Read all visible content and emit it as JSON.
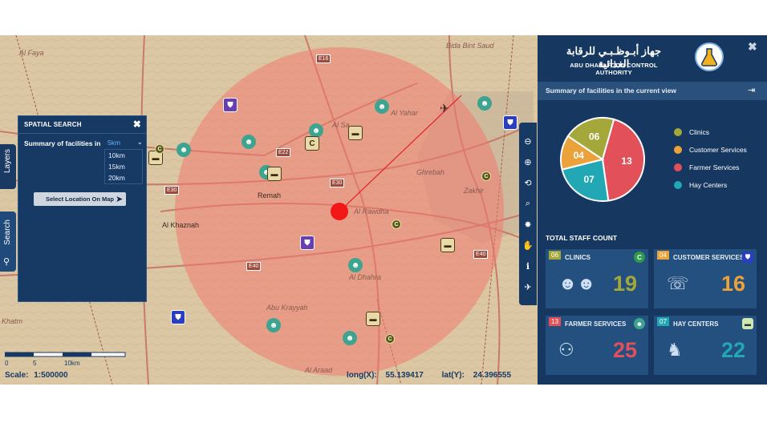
{
  "map": {
    "places": {
      "al_faya": "Al Faya",
      "bida_bint_saud": "Bida Bint Saud",
      "al_yahar": "Al Yahar",
      "al_sa": "Al Sa",
      "remah": "Remah",
      "al_khaznah": "Al Khaznah",
      "al_rawdha": "Al Rawdha",
      "ghrebah": "Ghrebah",
      "zakhir": "Zakhir",
      "al_dhahra": "Al Dhahra",
      "abu_krayyah": "Abu Krayyah",
      "khatm": "Khatm",
      "al_araad": "Al Araad"
    },
    "road_shields": [
      "E16",
      "E22",
      "E30",
      "E30",
      "E40",
      "E40"
    ],
    "scale_ticks": [
      "0",
      "5",
      "10km"
    ],
    "scale_label": "Scale:",
    "scale_value": "1:500000",
    "long_label": "long(X):",
    "long_value": "55.139417",
    "lat_label": "lat(Y):",
    "lat_value": "24.396555"
  },
  "side_tabs": {
    "layers": "Layers",
    "search": "Search"
  },
  "spatial_search": {
    "title": "SPATIAL SEARCH",
    "close": "✖",
    "summary_label": "Summary of facilities in",
    "selected": "5km",
    "options": [
      "10km",
      "15km",
      "20km"
    ],
    "button": "Select Location On Map"
  },
  "panel": {
    "arabic_name": "جهاز أبـوظـبـي للرقابة الغذائية",
    "english_name": "ABU DHABI FOOD CONTROL AUTHORITY",
    "close": "✖",
    "summary_title": "Summary of facilities in the current view",
    "legend": [
      {
        "label": "Clinics",
        "color": "#a4a83a"
      },
      {
        "label": "Customer Services",
        "color": "#eba23a"
      },
      {
        "label": "Farmer Services",
        "color": "#e2505a"
      },
      {
        "label": "Hay Centers",
        "color": "#22a7b5"
      }
    ],
    "pie": [
      {
        "label": "06",
        "value": 6,
        "color": "#a4a83a"
      },
      {
        "label": "13",
        "value": 13,
        "color": "#e2505a"
      },
      {
        "label": "07",
        "value": 7,
        "color": "#22a7b5"
      },
      {
        "label": "04",
        "value": 4,
        "color": "#eba23a"
      }
    ],
    "staff_title": "TOTAL STAFF COUNT",
    "cards": [
      {
        "num": "06",
        "title": "CLINICS",
        "value": "19",
        "color": "#a4a83a"
      },
      {
        "num": "04",
        "title": "CUSTOMER SERVICES",
        "value": "16",
        "color": "#eba23a"
      },
      {
        "num": "13",
        "title": "FARMER SERVICES",
        "value": "25",
        "color": "#e2505a"
      },
      {
        "num": "07",
        "title": "HAY CENTERS",
        "value": "22",
        "color": "#22a7b5"
      }
    ]
  }
}
